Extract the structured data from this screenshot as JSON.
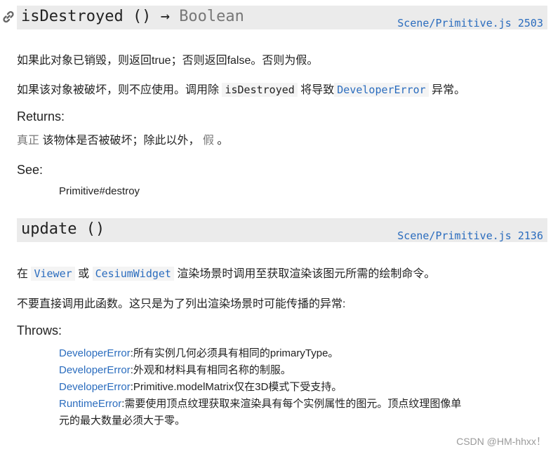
{
  "section1": {
    "signature": "isDestroyed ()",
    "arrow": "→",
    "return_type": "Boolean",
    "source": "Scene/Primitive.js 2503",
    "desc1": "如果此对象已销毁，则返回true；否则返回false。否则为假。",
    "desc2_pre": "如果该对象被破坏，则不应使用。调用除",
    "desc2_code1": "isDestroyed",
    "desc2_mid": "将导致",
    "desc2_code2": "DeveloperError",
    "desc2_post": "异常。",
    "returns_label": "Returns:",
    "returns_true": "真正",
    "returns_mid": "该物体是否被破坏；除此以外，",
    "returns_false": "假",
    "returns_end": "。",
    "see_label": "See:",
    "see_link": "Primitive#destroy"
  },
  "section2": {
    "signature": "update ()",
    "source": "Scene/Primitive.js 2136",
    "desc1_pre": "在",
    "desc1_code1": "Viewer",
    "desc1_mid": "或",
    "desc1_code2": "CesiumWidget",
    "desc1_post": "渲染场景时调用至获取渲染该图元所需的绘制命令。",
    "desc2": "不要直接调用此函数。这只是为了列出渲染场景时可能传播的异常:",
    "throws_label": "Throws:",
    "throws": [
      {
        "type": "DeveloperError",
        "text": ":所有实例几何必须具有相同的primaryType。"
      },
      {
        "type": "DeveloperError",
        "text": ":外观和材料具有相同名称的制服。"
      },
      {
        "type": "DeveloperError",
        "text": ":Primitive.modelMatrix仅在3D模式下受支持。"
      },
      {
        "type": "RuntimeError",
        "text": ":需要使用顶点纹理获取来渲染具有每个实例属性的图元。顶点纹理图像单",
        "text2": "元的最大数量必须大于零。"
      }
    ]
  },
  "watermark": "CSDN @HM-hhxx！",
  "icons": {
    "link": "link-icon"
  },
  "colors": {
    "link": "#2a6cbe",
    "header_bg": "#ebebeb",
    "muted": "#777777"
  }
}
